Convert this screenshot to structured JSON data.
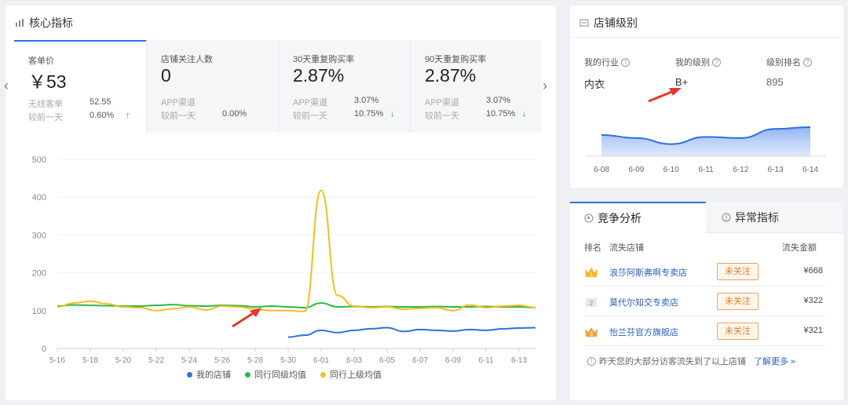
{
  "core": {
    "title": "核心指标",
    "cards": [
      {
        "title": "客单价",
        "value": "￥53",
        "row1_label": "无线客单",
        "row1_value": "52.55",
        "row2_label": "较前一天",
        "row2_value": "0.60%",
        "trend": "↑"
      },
      {
        "title": "店铺关注人数",
        "value": "0",
        "row1_label": "APP渠道",
        "row1_value": "",
        "row2_label": "较前一天",
        "row2_value": "0.00%",
        "trend": ""
      },
      {
        "title": "30天重复购买率",
        "value": "2.87%",
        "row1_label": "APP渠道",
        "row1_value": "3.07%",
        "row2_label": "较前一天",
        "row2_value": "10.75%",
        "trend": "↓"
      },
      {
        "title": "90天重复购买率",
        "value": "2.87%",
        "row1_label": "APP渠道",
        "row1_value": "3.07%",
        "row2_label": "较前一天",
        "row2_value": "10.75%",
        "trend": "↓"
      }
    ],
    "prev_arrow": "‹",
    "next_arrow": "›"
  },
  "level": {
    "title": "店铺级别",
    "industry_label": "我的行业",
    "industry_value": "内衣",
    "level_label": "我的级别",
    "level_value": "B+",
    "rank_label": "级别排名",
    "rank_value": "895"
  },
  "competition": {
    "tab_active": "竞争分析",
    "tab_inactive": "异常指标",
    "col_rank": "排名",
    "col_shop": "流失店铺",
    "col_amount": "流失金额",
    "rows": [
      {
        "rank": "1",
        "shop": "浪莎阿斯弗啊专卖店",
        "follow": "未关注",
        "loss": "¥668"
      },
      {
        "rank": "2",
        "shop": "莫代尔知交专卖店",
        "follow": "未关注",
        "loss": "¥322"
      },
      {
        "rank": "3",
        "shop": "怡兰芬官方旗舰店",
        "follow": "未关注",
        "loss": "¥321"
      }
    ],
    "note": "昨天您的大部分访客流失到了以上店铺",
    "more": "了解更多 »"
  },
  "colors": {
    "my_store": "#2f6fe0",
    "peer_same": "#2db84a",
    "peer_upper": "#f5bd1f",
    "accent": "#2f6fe0",
    "arrow": "#e8362d"
  },
  "chart_data": [
    {
      "type": "line",
      "title": "",
      "ylim": [
        0,
        500
      ],
      "yticks": [
        0,
        100,
        200,
        300,
        400,
        500
      ],
      "x": [
        "5-16",
        "5-17",
        "5-18",
        "5-19",
        "5-20",
        "5-21",
        "5-22",
        "5-23",
        "5-24",
        "5-25",
        "5-26",
        "5-27",
        "5-28",
        "5-29",
        "5-30",
        "5-31",
        "6-01",
        "6-02",
        "6-03",
        "6-04",
        "6-05",
        "6-06",
        "6-07",
        "6-08",
        "6-09",
        "6-10",
        "6-11",
        "6-12",
        "6-13",
        "6-14"
      ],
      "xticks": [
        "5-16",
        "5-18",
        "5-20",
        "5-22",
        "5-24",
        "5-26",
        "5-28",
        "5-30",
        "6-01",
        "6-03",
        "6-05",
        "6-07",
        "6-09",
        "6-11",
        "6-13"
      ],
      "grid": true,
      "legend": "bottom-center",
      "series": [
        {
          "name": "我的店铺",
          "values": [
            null,
            null,
            null,
            null,
            null,
            null,
            null,
            null,
            null,
            null,
            null,
            null,
            null,
            null,
            30,
            35,
            48,
            42,
            48,
            52,
            55,
            45,
            50,
            48,
            46,
            50,
            48,
            52,
            54,
            55
          ]
        },
        {
          "name": "同行同级均值",
          "values": [
            112,
            115,
            114,
            113,
            112,
            112,
            114,
            116,
            113,
            112,
            114,
            113,
            110,
            112,
            110,
            108,
            120,
            110,
            111,
            110,
            111,
            110,
            110,
            111,
            110,
            110,
            111,
            110,
            110,
            108
          ]
        },
        {
          "name": "同行上级均值",
          "values": [
            110,
            120,
            125,
            118,
            110,
            108,
            100,
            105,
            110,
            102,
            112,
            110,
            104,
            100,
            100,
            98,
            418,
            140,
            112,
            108,
            110,
            104,
            106,
            108,
            100,
            115,
            108,
            112,
            114,
            108
          ]
        }
      ]
    },
    {
      "type": "area",
      "title": "",
      "x": [
        "6-08",
        "6-09",
        "6-10",
        "6-11",
        "6-12",
        "6-13",
        "6-14"
      ],
      "values": [
        895,
        890,
        880,
        892,
        890,
        905,
        908
      ],
      "legend": "none"
    }
  ]
}
